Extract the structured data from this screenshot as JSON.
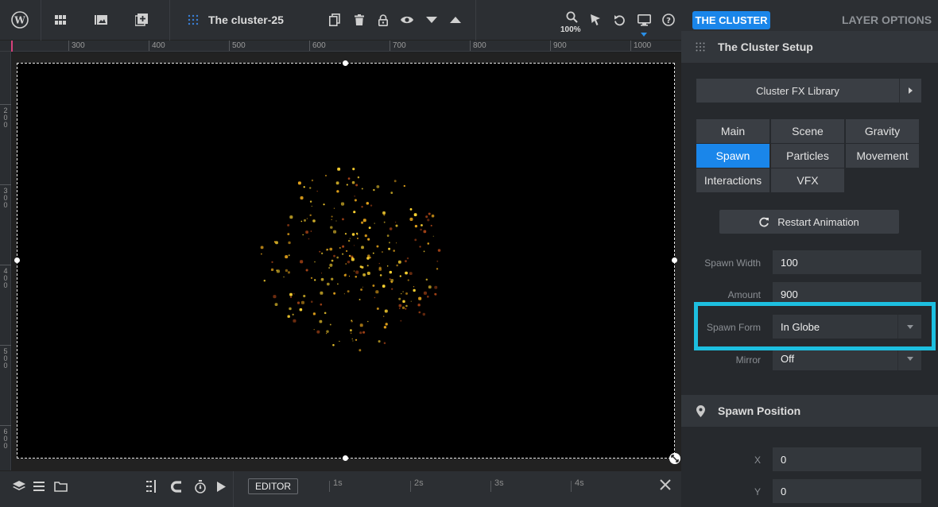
{
  "toolbar": {
    "title": "The cluster-25",
    "zoom": "100%"
  },
  "ruler": {
    "top_labels": [
      "300",
      "400",
      "500",
      "600",
      "700",
      "800",
      "900",
      "1000"
    ],
    "left_labels": [
      "200",
      "300",
      "400",
      "500",
      "600"
    ]
  },
  "timeline": {
    "editor_label": "EDITOR",
    "marks": [
      "1s",
      "2s",
      "3s",
      "4s"
    ]
  },
  "panel": {
    "tab_active": "THE CLUSTER",
    "tab_other": "LAYER OPTIONS",
    "section_setup": "The Cluster Setup",
    "fx_library": "Cluster FX Library",
    "subtabs": [
      "Main",
      "Scene",
      "Gravity",
      "Spawn",
      "Particles",
      "Movement",
      "Interactions",
      "VFX"
    ],
    "active_subtab": "Spawn",
    "restart": "Restart Animation",
    "fields": {
      "spawn_width_label": "Spawn Width",
      "spawn_width_value": "100",
      "amount_label": "Amount",
      "amount_value": "900",
      "spawn_form_label": "Spawn Form",
      "spawn_form_value": "In Globe",
      "mirror_label": "Mirror",
      "mirror_value": "Off"
    },
    "section_position": "Spawn Position",
    "position": {
      "x_label": "X",
      "x_value": "0",
      "y_label": "Y",
      "y_value": "0"
    }
  },
  "colors": {
    "accent": "#1a86ea",
    "highlight": "#1dbfe0",
    "particle_gold": "#ffd531",
    "particle_amber": "#e3a21a",
    "particle_red": "#a34216"
  },
  "icons": [
    "wordpress-icon",
    "grid-icon",
    "media-icon",
    "add-layer-icon",
    "cluster-icon",
    "copy-icon",
    "trash-icon",
    "lock-icon",
    "eye-icon",
    "arrow-down-icon",
    "arrow-up-icon",
    "zoom-icon",
    "cursor-icon",
    "undo-icon",
    "monitor-icon",
    "help-icon",
    "layers-icon",
    "menu-icon",
    "folder-icon",
    "guides-icon",
    "magnet-icon",
    "timer-icon",
    "play-icon",
    "close-icon",
    "refresh-icon",
    "pin-icon",
    "caret-down-icon",
    "caret-right-icon"
  ]
}
